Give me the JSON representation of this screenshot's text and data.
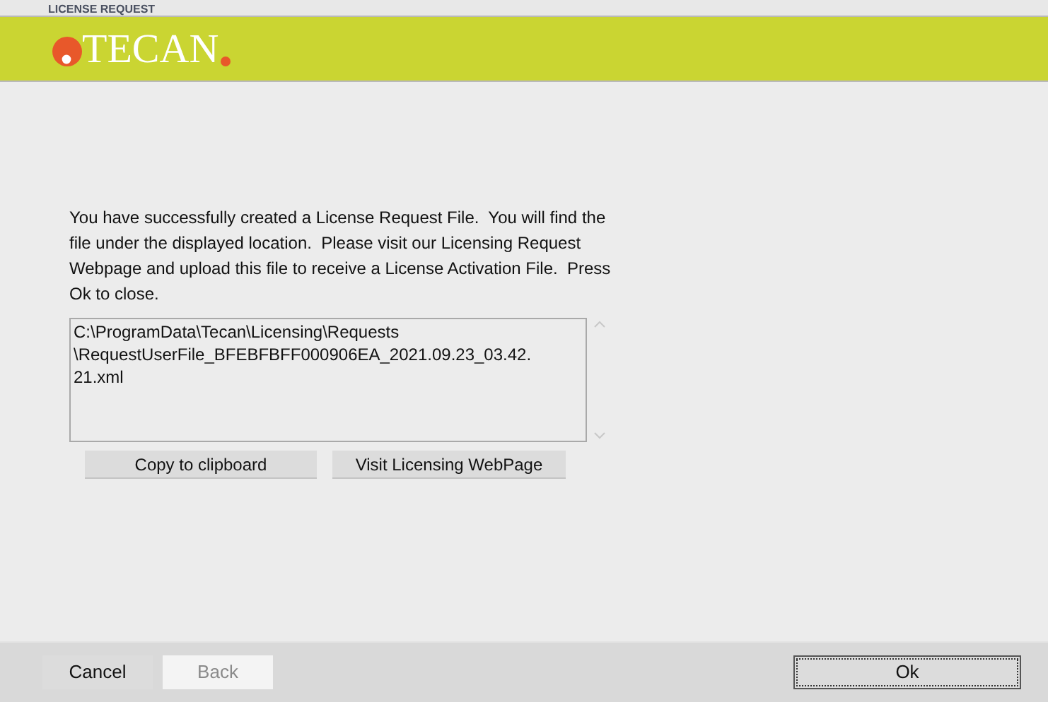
{
  "window": {
    "title": "LICENSE REQUEST"
  },
  "logo": {
    "text": "TECAN"
  },
  "message": "You have successfully created a License Request File.  You will find the file under the displayed location.  Please visit our Licensing Request Webpage and upload this file to receive a License Activation File.  Press Ok to close.",
  "file_path": {
    "value": "C:\\ProgramData\\Tecan\\Licensing\\Requests\n\\RequestUserFile_BFEBFBFF000906EA_2021.09.23_03.42.\n21.xml"
  },
  "actions": [
    "Copy to clipboard",
    "Visit Licensing WebPage"
  ],
  "footer_buttons": [
    {
      "label": "Cancel",
      "disabled": false,
      "focused": false
    },
    {
      "label": "Back",
      "disabled": true,
      "focused": false
    },
    {
      "label": "Ok",
      "disabled": false,
      "focused": true
    }
  ]
}
